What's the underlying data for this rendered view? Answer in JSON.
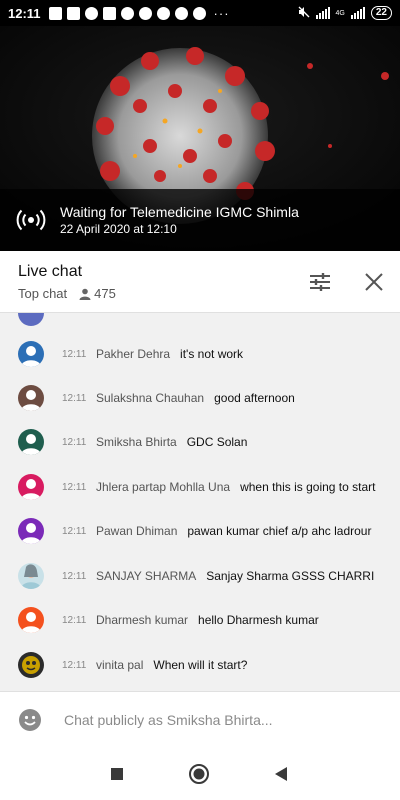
{
  "status_bar": {
    "time": "12:11",
    "battery": "22",
    "network_label": "4G"
  },
  "video": {
    "title": "Waiting for Telemedicine IGMC Shimla",
    "scheduled": "22 April 2020 at 12:10"
  },
  "chat_header": {
    "title": "Live chat",
    "mode": "Top chat",
    "viewer_count": "475"
  },
  "messages": [
    {
      "time": "12:11",
      "author": "Pakher Dehra",
      "text": "it's not work",
      "avatar_color": "#2c6fb6"
    },
    {
      "time": "12:11",
      "author": "Sulakshna Chauhan",
      "text": "good afternoon",
      "avatar_color": "#6d4c41"
    },
    {
      "time": "12:11",
      "author": "Smiksha Bhirta",
      "text": "GDC Solan",
      "avatar_color": "#1f5e4e"
    },
    {
      "time": "12:11",
      "author": "Jhlera partap Mohlla Una",
      "text": "when this is going to start",
      "avatar_color": "#d81b60"
    },
    {
      "time": "12:11",
      "author": "Pawan Dhiman",
      "text": "pawan kumar chief a/p ahc ladrour",
      "avatar_color": "#7b2ab8"
    },
    {
      "time": "12:11",
      "author": "SANJAY SHARMA",
      "text": "Sanjay Sharma GSSS CHARRI",
      "avatar_color": "#9ec9d6"
    },
    {
      "time": "12:11",
      "author": "Dharmesh kumar",
      "text": "hello Dharmesh kumar",
      "avatar_color": "#f4511e"
    },
    {
      "time": "12:11",
      "author": "vinita pal",
      "text": "When will it start?",
      "avatar_color": "#c8a000"
    }
  ],
  "chat_input": {
    "placeholder": "Chat publicly as Smiksha Bhirta..."
  },
  "icons": {
    "live": "broadcast-icon",
    "filter": "sliders-icon",
    "close": "close-icon",
    "viewers": "person-icon",
    "emoji": "emoji-icon",
    "nav": [
      "square-recents-icon",
      "circle-home-icon",
      "triangle-back-icon"
    ]
  }
}
